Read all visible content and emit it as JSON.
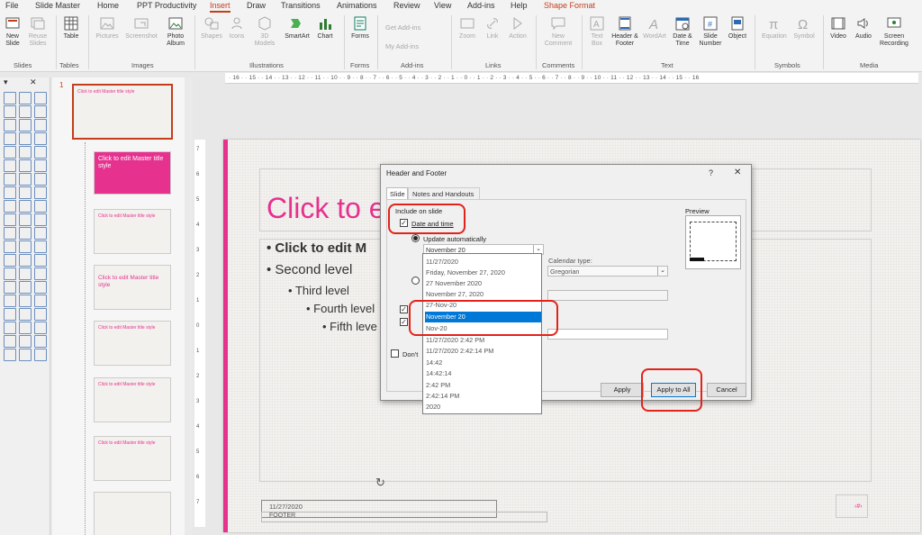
{
  "menu": {
    "tabs": [
      "File",
      "Slide Master",
      "Home",
      "PPT Productivity",
      "Insert",
      "Draw",
      "Transitions",
      "Animations",
      "Review",
      "View",
      "Add-ins",
      "Help",
      "Shape Format"
    ],
    "active": "Insert"
  },
  "ribbon": {
    "new_slide": "New Slide",
    "reuse_slides": "Reuse Slides",
    "table": "Table",
    "pictures": "Pictures",
    "screenshot": "Screenshot",
    "photo_album": "Photo Album",
    "shapes": "Shapes",
    "icons": "Icons",
    "models_3d": "3D Models",
    "smartart": "SmartArt",
    "chart": "Chart",
    "forms": "Forms",
    "get_addins": "Get Add-ins",
    "my_addins": "My Add-ins",
    "zoom": "Zoom",
    "link": "Link",
    "action": "Action",
    "new_comment": "New Comment",
    "text_box": "Text Box",
    "header_footer": "Header & Footer",
    "wordart": "WordArt",
    "date_time": "Date & Time",
    "slide_number": "Slide Number",
    "object": "Object",
    "equation": "Equation",
    "symbol": "Symbol",
    "video": "Video",
    "audio": "Audio",
    "screen_recording": "Screen Recording",
    "groups": [
      "Slides",
      "Tables",
      "Images",
      "Illustrations",
      "Forms",
      "Add-ins",
      "Links",
      "Comments",
      "Text",
      "Symbols",
      "Media"
    ]
  },
  "ruler": {
    "ticks": "· 16 · · 15 · · 14 · · 13 · · 12 · · 11 · · 10 · · 9 · · 8 · · 7 · · 6 · · 5 · · 4 · · 3 · · 2 · · 1 · · 0 · · 1 · · 2 · · 3 · · 4 · · 5 · · 6 · · 7 · · 8 · · 9 · · 10 · · 11 · · 12 · · 13 · · 14 · · 15 · · 16",
    "vticks": [
      "7",
      "6",
      "5",
      "4",
      "3",
      "2",
      "1",
      "0",
      "1",
      "2",
      "3",
      "4",
      "5",
      "6",
      "7"
    ]
  },
  "thumbs": {
    "slide_number": "1",
    "master_title": "Click to edit Master title style",
    "small_title": "Click to edit Master title style"
  },
  "slide": {
    "title": "Click to e",
    "bullets": [
      "Click to edit M",
      "Second level",
      "Third level",
      "Fourth level",
      "Fifth leve"
    ],
    "footer_date": "11/27/2020",
    "footer_text": "FOOTER",
    "page_marker": "‹#›"
  },
  "dialog": {
    "title": "Header and Footer",
    "help": "?",
    "close": "✕",
    "tabs": [
      "Slide",
      "Notes and Handouts"
    ],
    "include_on_slide": "Include on slide",
    "date_and_time": "Date and time",
    "update_automatically": "Update automatically",
    "selected_value": "November 20",
    "calendar_type_label": "Calendar type:",
    "calendar_type": "Gregorian",
    "preview": "Preview",
    "dont_show": "Don't",
    "apply": "Apply",
    "apply_all": "Apply to All",
    "cancel": "Cancel",
    "options": [
      "11/27/2020",
      "Friday, November 27, 2020",
      "27 November 2020",
      "November 27, 2020",
      "27-Nov-20",
      "November 20",
      "Nov-20",
      "11/27/2020 2:42 PM",
      "11/27/2020 2:42:14 PM",
      "14:42",
      "14:42:14",
      "2:42 PM",
      "2:42:14 PM",
      "2020"
    ],
    "selected_index": 5
  },
  "colors": {
    "accent": "#e6318f",
    "ribbon_active": "#c43e1c",
    "selection": "#0078d7",
    "annotation": "#e2231a"
  }
}
